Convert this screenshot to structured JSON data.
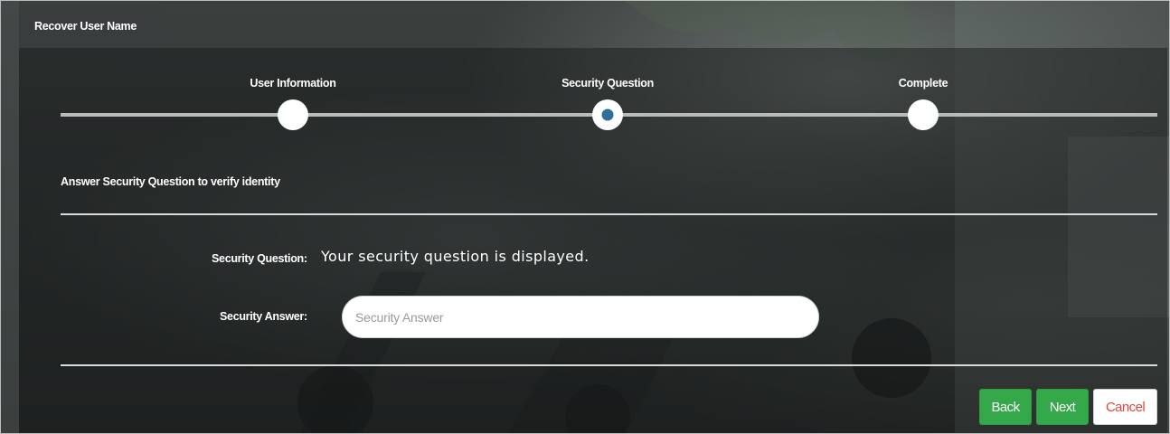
{
  "tab": {
    "title": "Recover User Name"
  },
  "steps": [
    {
      "label": "User Information",
      "state": "inactive"
    },
    {
      "label": "Security Question",
      "state": "active"
    },
    {
      "label": "Complete",
      "state": "inactive"
    }
  ],
  "instruction": "Answer Security Question to verify identity",
  "security_question": {
    "label": "Security Question:",
    "text": "Your security question is displayed."
  },
  "security_answer": {
    "label": "Security Answer:",
    "value": "",
    "placeholder": "Security Answer"
  },
  "buttons": {
    "back": "Back",
    "next": "Next",
    "cancel": "Cancel"
  },
  "colors": {
    "accent_green": "#35a84a",
    "cancel_red": "#e0473f",
    "active_step_dot": "#2f6e9c"
  }
}
